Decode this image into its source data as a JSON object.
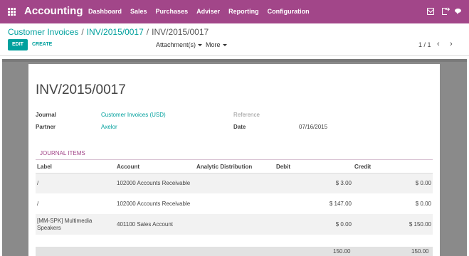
{
  "topbar": {
    "app_title": "Accounting",
    "menu": [
      "Dashboard",
      "Sales",
      "Purchases",
      "Adviser",
      "Reporting",
      "Configuration"
    ],
    "icons": [
      "mail-icon",
      "sign-out-icon",
      "chat-icon"
    ],
    "color": "#a24689"
  },
  "breadcrumb": {
    "items": [
      "Customer Invoices",
      "INV/2015/0017"
    ],
    "active": "INV/2015/0017",
    "separator": "/"
  },
  "toolbar": {
    "edit_label": "EDIT",
    "create_label": "CREATE",
    "attachments_label": "Attachment(s)",
    "more_label": "More",
    "pager": "1 / 1",
    "accent": "#00a09d"
  },
  "invoice": {
    "title": "INV/2015/0017",
    "journal_label": "Journal",
    "journal_value": "Customer Invoices (USD)",
    "partner_label": "Partner",
    "partner_value": "Axelor",
    "reference_label": "Reference",
    "reference_value": "",
    "date_label": "Date",
    "date_value": "07/16/2015"
  },
  "journal_items": {
    "tab_label": "JOURNAL ITEMS",
    "columns": [
      "Label",
      "Account",
      "Analytic Distribution",
      "Debit",
      "Credit"
    ],
    "rows": [
      {
        "label": "/",
        "account": "102000 Accounts Receivable",
        "analytic": "",
        "debit": "$ 3.00",
        "credit": "$ 0.00"
      },
      {
        "label": "/",
        "account": "102000 Accounts Receivable",
        "analytic": "",
        "debit": "$ 147.00",
        "credit": "$ 0.00"
      },
      {
        "label": "[MM-SPK] Multimedia Speakers",
        "account": "401100 Sales Account",
        "analytic": "",
        "debit": "$ 0.00",
        "credit": "$ 150.00"
      }
    ],
    "total_debit": "150.00",
    "total_credit": "150.00"
  }
}
